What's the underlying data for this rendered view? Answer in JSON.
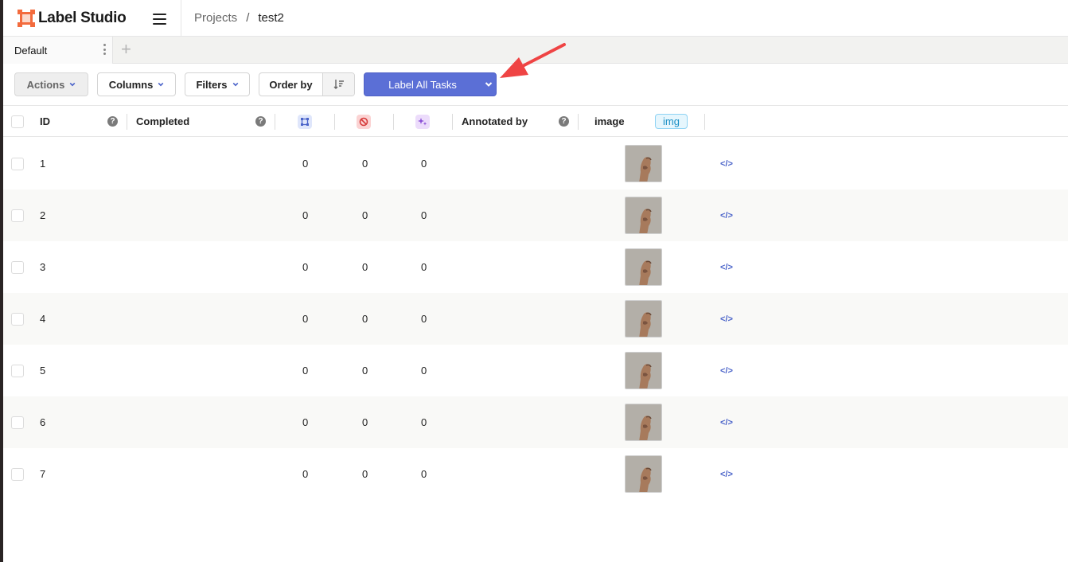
{
  "app": {
    "name": "Label Studio"
  },
  "breadcrumb": {
    "projects": "Projects",
    "separator": "/",
    "current": "test2"
  },
  "tabs": [
    {
      "label": "Default"
    }
  ],
  "toolbar": {
    "actions": "Actions",
    "columns": "Columns",
    "filters": "Filters",
    "order_by": "Order by",
    "label_all": "Label All Tasks"
  },
  "colors": {
    "brand": "#f36b3d",
    "primary_button": "#5b6fd6",
    "arrow": "#ef4444"
  },
  "table": {
    "headers": {
      "id": "ID",
      "completed": "Completed",
      "annotations_icon": "annotations-icon",
      "cancelled_icon": "cancelled-icon",
      "predictions_icon": "predictions-icon",
      "annotated_by": "Annotated by",
      "image": "image",
      "image_tag": "img"
    },
    "rows": [
      {
        "id": "1",
        "completed": "",
        "annotations": "0",
        "cancelled": "0",
        "predictions": "0"
      },
      {
        "id": "2",
        "completed": "",
        "annotations": "0",
        "cancelled": "0",
        "predictions": "0"
      },
      {
        "id": "3",
        "completed": "",
        "annotations": "0",
        "cancelled": "0",
        "predictions": "0"
      },
      {
        "id": "4",
        "completed": "",
        "annotations": "0",
        "cancelled": "0",
        "predictions": "0"
      },
      {
        "id": "5",
        "completed": "",
        "annotations": "0",
        "cancelled": "0",
        "predictions": "0"
      },
      {
        "id": "6",
        "completed": "",
        "annotations": "0",
        "cancelled": "0",
        "predictions": "0"
      },
      {
        "id": "7",
        "completed": "",
        "annotations": "0",
        "cancelled": "0",
        "predictions": "0"
      }
    ],
    "source_icon": "code-icon"
  }
}
